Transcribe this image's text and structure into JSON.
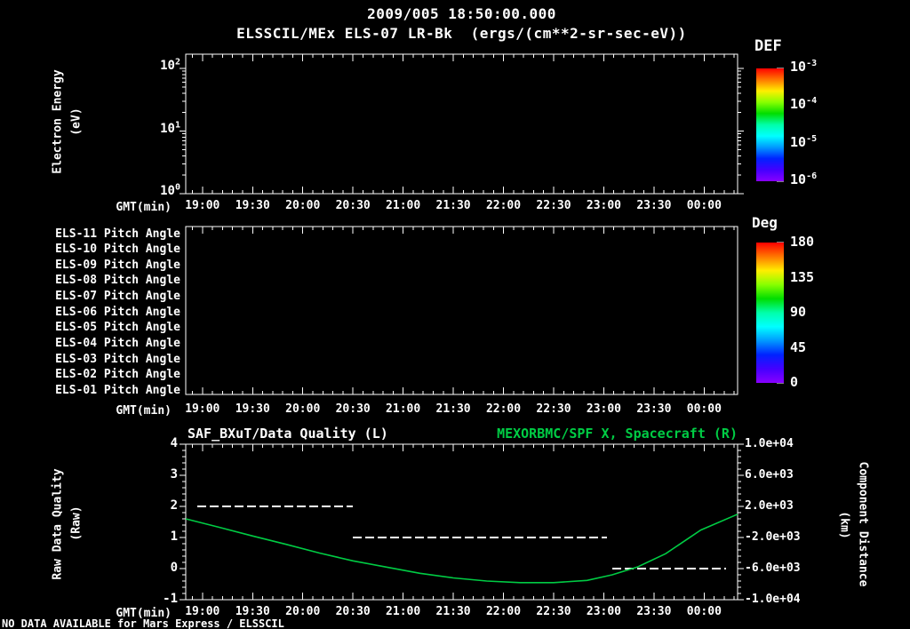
{
  "header": {
    "datetime": "2009/005 18:50:00.000",
    "subtitle": "ELSSCIL/MEx ELS-07 LR-Bk  (ergs/(cm**2-sr-sec-eV))"
  },
  "footer": {
    "no_data_text": "NO DATA AVAILABLE for Mars Express / ELSSCIL"
  },
  "labels": {
    "energy_lines": [
      "Electron Energy",
      "(eV)"
    ],
    "quality_left_lines": [
      "Raw Data Quality",
      "(Raw)"
    ],
    "distance_right_lines": [
      "Component Distance",
      "(km)"
    ]
  },
  "colors": {
    "background": "#000000",
    "foreground": "#ffffff",
    "green": "#00cc44",
    "rainbow_top_to_bottom": [
      "#ff0000",
      "#ff7700",
      "#ffee00",
      "#88ff00",
      "#00dd00",
      "#00ffaa",
      "#00ffff",
      "#0099ff",
      "#0022ff",
      "#4400ff",
      "#8800ff"
    ]
  },
  "chart_data": [
    {
      "id": "electron-energy-spectrogram",
      "type": "heatmap",
      "title": "ELSSCIL/MEx ELS-07 LR-Bk (ergs/(cm**2-sr-sec-eV))",
      "xlabel": "GMT(min)",
      "x_start_time": "18:50",
      "x_range_minutes": [
        0,
        330
      ],
      "x_tick_labels": [
        "19:00",
        "19:30",
        "20:00",
        "20:30",
        "21:00",
        "21:30",
        "22:00",
        "22:30",
        "23:00",
        "23:30",
        "00:00"
      ],
      "ylabel": "Electron Energy (eV)",
      "y_scale": "log",
      "y_tick_exponents": [
        2,
        1,
        0
      ],
      "colorbar": {
        "title": "DEF",
        "scale": "log",
        "tick_exponents": [
          -3,
          -4,
          -5,
          -6
        ]
      },
      "values": [],
      "note": "panel empty - no data plotted"
    },
    {
      "id": "pitch-angle-rows",
      "type": "heatmap",
      "row_labels": [
        "ELS-11 Pitch Angle",
        "ELS-10 Pitch Angle",
        "ELS-09 Pitch Angle",
        "ELS-08 Pitch Angle",
        "ELS-07 Pitch Angle",
        "ELS-06 Pitch Angle",
        "ELS-05 Pitch Angle",
        "ELS-04 Pitch Angle",
        "ELS-03 Pitch Angle",
        "ELS-02 Pitch Angle",
        "ELS-01 Pitch Angle"
      ],
      "xlabel": "GMT(min)",
      "x_tick_labels": [
        "19:00",
        "19:30",
        "20:00",
        "20:30",
        "21:00",
        "21:30",
        "22:00",
        "22:30",
        "23:00",
        "23:30",
        "00:00"
      ],
      "colorbar": {
        "title": "Deg",
        "tick_values": [
          180,
          135,
          90,
          45,
          0
        ]
      },
      "values": [],
      "note": "panel empty - no data plotted"
    },
    {
      "id": "quality-and-distance",
      "type": "line",
      "title_left": "SAF_BXuT/Data Quality (L)",
      "title_right": "MEXORBMC/SPF X, Spacecraft (R)",
      "xlabel": "GMT(min)",
      "x_start_time": "18:50",
      "x_range_minutes": [
        0,
        330
      ],
      "x_tick_labels": [
        "19:00",
        "19:30",
        "20:00",
        "20:30",
        "21:00",
        "21:30",
        "22:00",
        "22:30",
        "23:00",
        "23:30",
        "00:00"
      ],
      "left_axis": {
        "label": "Raw Data Quality (Raw)",
        "ticks": [
          4,
          3,
          2,
          1,
          0,
          -1
        ],
        "range": [
          -1,
          4
        ]
      },
      "right_axis": {
        "label": "Component Distance (km)",
        "tick_labels": [
          "1.0e+04",
          "6.0e+03",
          "2.0e+03",
          "-2.0e+03",
          "-6.0e+03",
          "-1.0e+04"
        ],
        "range": [
          -10000,
          10000
        ]
      },
      "series": [
        {
          "name": "SAF_BXuT/Data Quality",
          "axis": "left",
          "style": {
            "color": "#ffffff",
            "dashed": true
          },
          "steps": [
            {
              "value": 2,
              "t_minutes": [
                7,
                100
              ]
            },
            {
              "value": 1,
              "t_minutes": [
                100,
                252
              ]
            },
            {
              "value": 0,
              "t_minutes": [
                255,
                323
              ]
            }
          ]
        },
        {
          "name": "MEXORBMC/SPF X Spacecraft",
          "axis": "right",
          "style": {
            "color": "#00cc44",
            "dashed": false
          },
          "points_t_km": [
            [
              0,
              400
            ],
            [
              20,
              -680
            ],
            [
              40,
              -1800
            ],
            [
              60,
              -2880
            ],
            [
              80,
              -4000
            ],
            [
              100,
              -5000
            ],
            [
              120,
              -5800
            ],
            [
              140,
              -6600
            ],
            [
              160,
              -7200
            ],
            [
              180,
              -7600
            ],
            [
              200,
              -7800
            ],
            [
              220,
              -7800
            ],
            [
              240,
              -7520
            ],
            [
              255,
              -6800
            ],
            [
              270,
              -5800
            ],
            [
              287,
              -4080
            ],
            [
              308,
              -1040
            ],
            [
              330,
              1000
            ]
          ]
        }
      ]
    }
  ]
}
